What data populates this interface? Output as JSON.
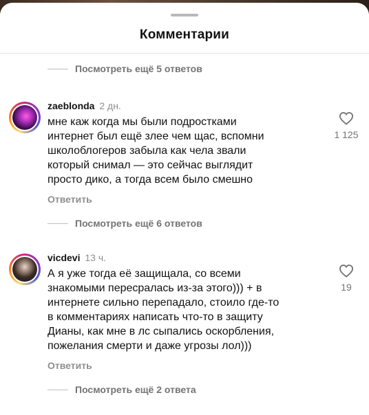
{
  "header": {
    "title": "Комментарии"
  },
  "replies_toggles": [
    {
      "label": "Посмотреть ещё 5 ответов"
    },
    {
      "label": "Посмотреть ещё 6 ответов"
    },
    {
      "label": "Посмотреть ещё 2 ответа"
    }
  ],
  "comments": [
    {
      "username": "zaeblonda",
      "time": "2 дн.",
      "text": "мне каж когда мы были подростками\nинтернет был ещё злее чем щас, вспомни\nшколоблогеров забыла как чела звали\nкоторый снимал — это сейчас выглядит\nпросто дико, а тогда всем было смешно",
      "reply_label": "Ответить",
      "likes": "1 125"
    },
    {
      "username": "vicdevi",
      "time": "13 ч.",
      "text": "А я уже тогда её защищала, со всеми\nзнакомыми пересралась из-за этого))) + в\nинтернете сильно перепадало, стоило где-то\nв комментариях написать что-то в защиту\nДианы, как мне в лс сыпались оскорбления,\nпожелания смерти и даже угрозы лол)))",
      "reply_label": "Ответить",
      "likes": "19"
    }
  ],
  "icons": {
    "like": "heart-icon",
    "grabber": "drag-handle"
  }
}
